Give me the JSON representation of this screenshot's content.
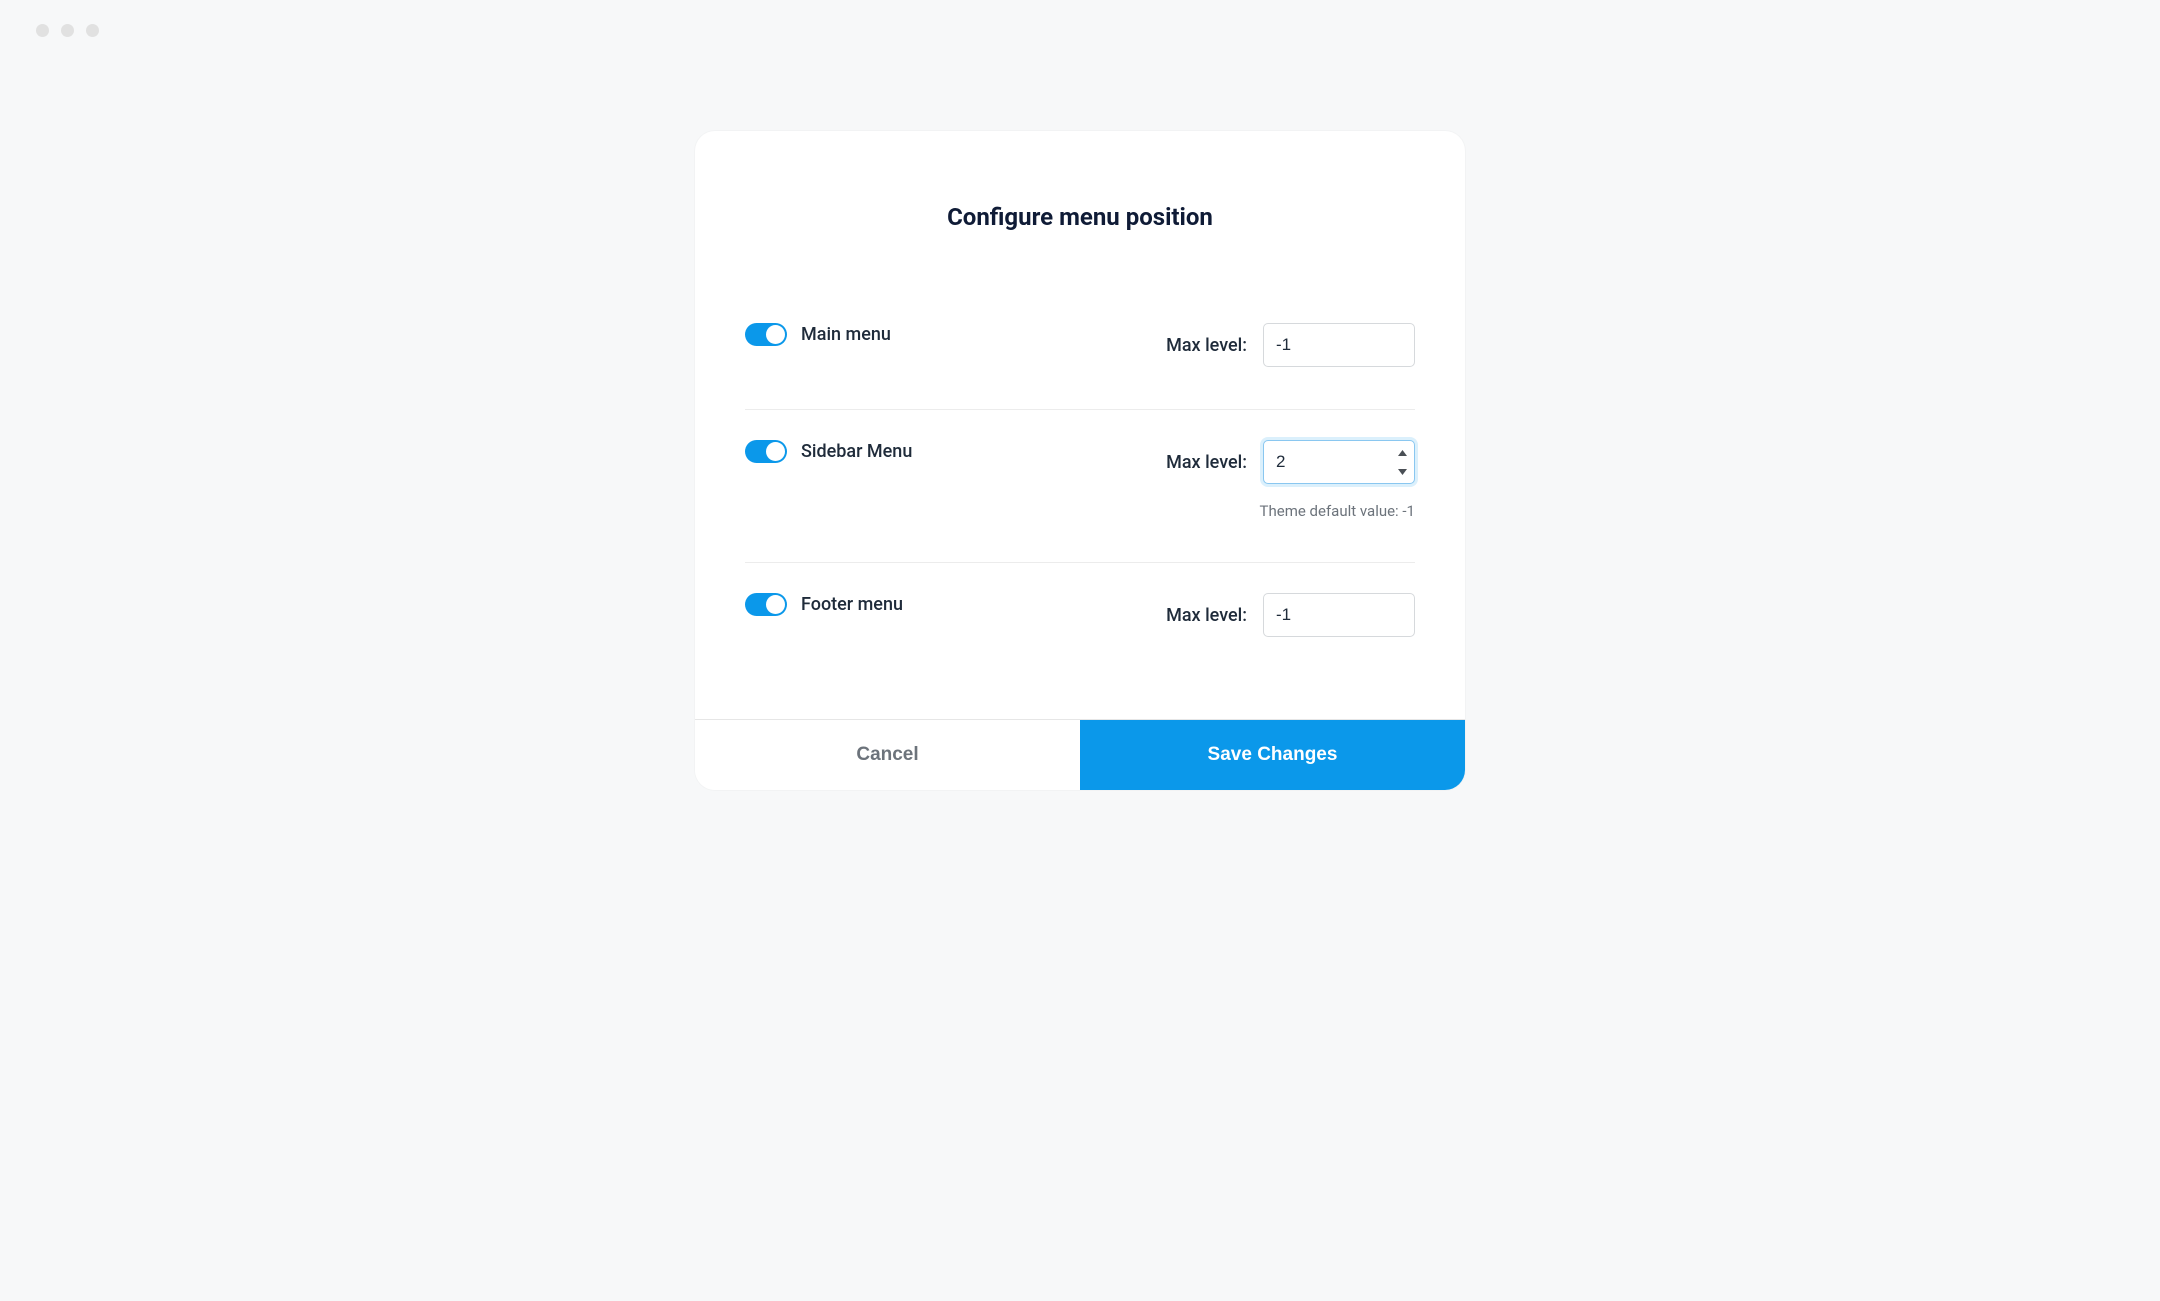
{
  "dialog": {
    "title": "Configure menu position",
    "rows": [
      {
        "toggle_label": "Main menu",
        "field_label": "Max level:",
        "value": "-1",
        "helper": null,
        "focused": false
      },
      {
        "toggle_label": "Sidebar Menu",
        "field_label": "Max level:",
        "value": "2",
        "helper": "Theme default value: -1",
        "focused": true
      },
      {
        "toggle_label": "Footer menu",
        "field_label": "Max level:",
        "value": "-1",
        "helper": null,
        "focused": false
      }
    ],
    "actions": {
      "cancel": "Cancel",
      "save": "Save Changes"
    }
  }
}
